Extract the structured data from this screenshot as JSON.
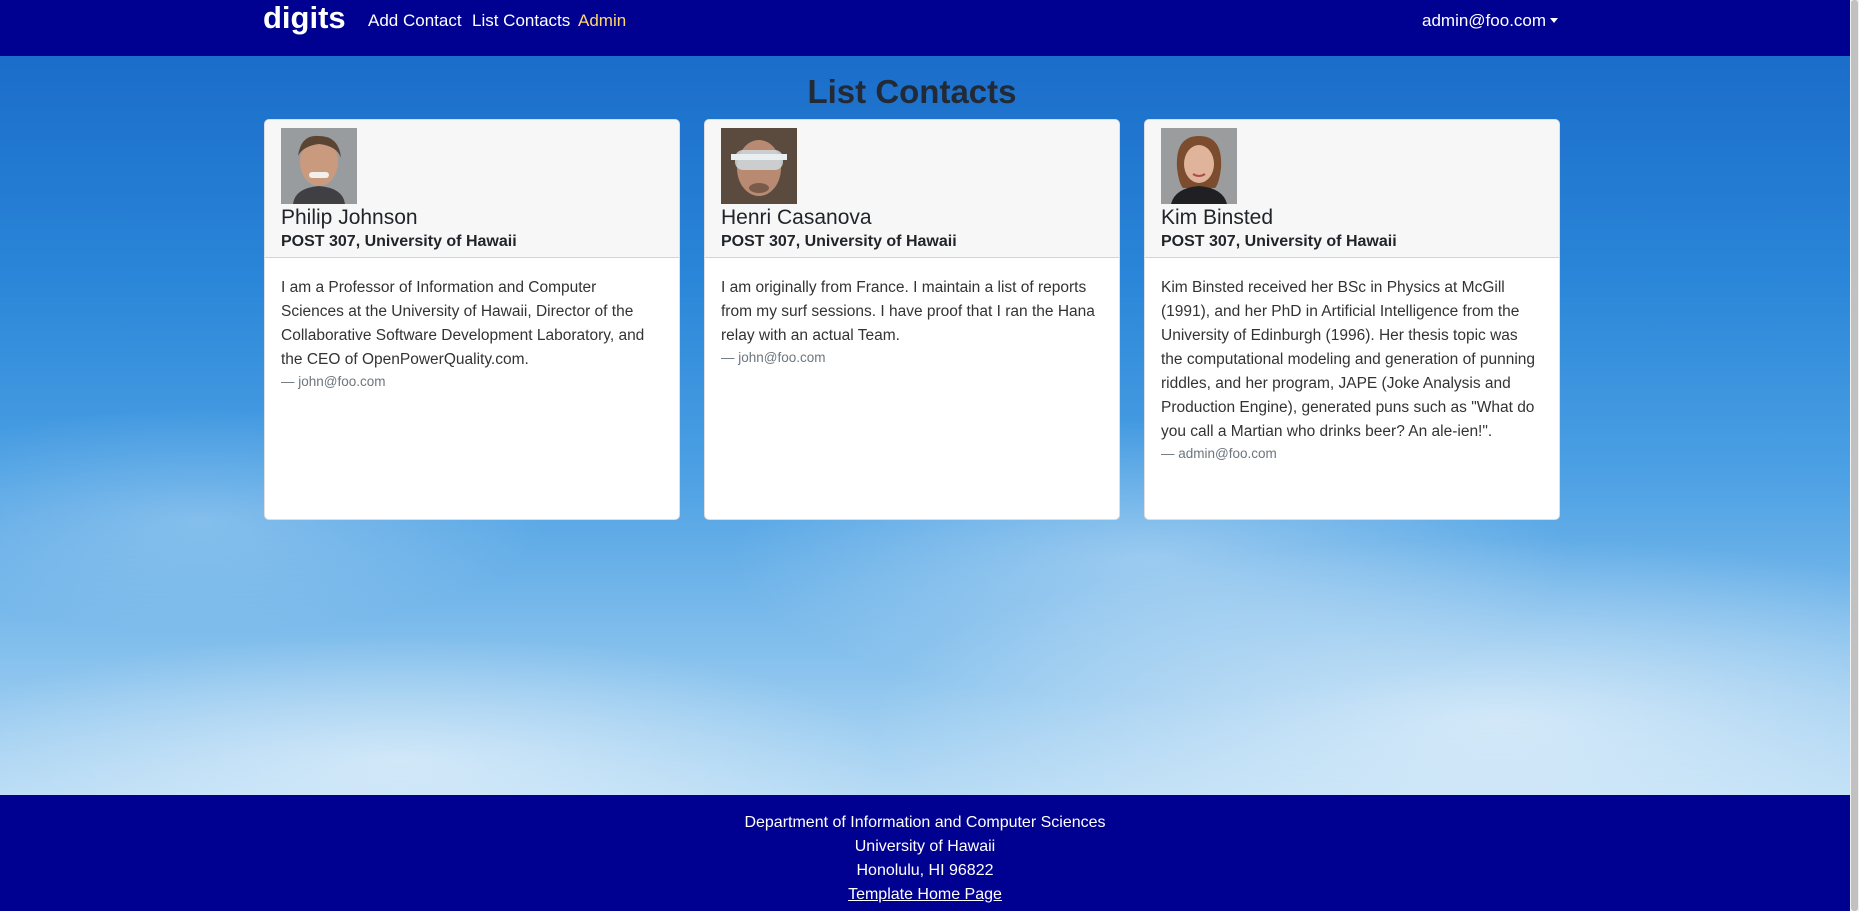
{
  "navbar": {
    "brand": "digits",
    "links": [
      {
        "label": "Add Contact"
      },
      {
        "label": "List Contacts"
      },
      {
        "label": "Admin"
      }
    ],
    "user": "admin@foo.com"
  },
  "page_title": "List Contacts",
  "contacts": [
    {
      "name": "Philip Johnson",
      "address": "POST 307, University of Hawaii",
      "description": "I am a Professor of Information and Computer Sciences at the University of Hawaii, Director of the Collaborative Software Development Laboratory, and the CEO of OpenPowerQuality.com.",
      "owner": "— john@foo.com"
    },
    {
      "name": "Henri Casanova",
      "address": "POST 307, University of Hawaii",
      "description": "I am originally from France. I maintain a list of reports from my surf sessions. I have proof that I ran the Hana relay with an actual Team.",
      "owner": "— john@foo.com"
    },
    {
      "name": "Kim Binsted",
      "address": "POST 307, University of Hawaii",
      "description": "Kim Binsted received her BSc in Physics at McGill (1991), and her PhD in Artificial Intelligence from the University of Edinburgh (1996). Her thesis topic was the computational modeling and generation of punning riddles, and her program, JAPE (Joke Analysis and Production Engine), generated puns such as \"What do you call a Martian who drinks beer? An ale-ien!\".",
      "owner": "— admin@foo.com"
    }
  ],
  "footer": {
    "line1": "Department of Information and Computer Sciences",
    "line2": "University of Hawaii",
    "line3": "Honolulu, HI 96822",
    "link": "Template Home Page"
  },
  "colors": {
    "navbar": "#000190",
    "admin_link": "#ffd869"
  }
}
